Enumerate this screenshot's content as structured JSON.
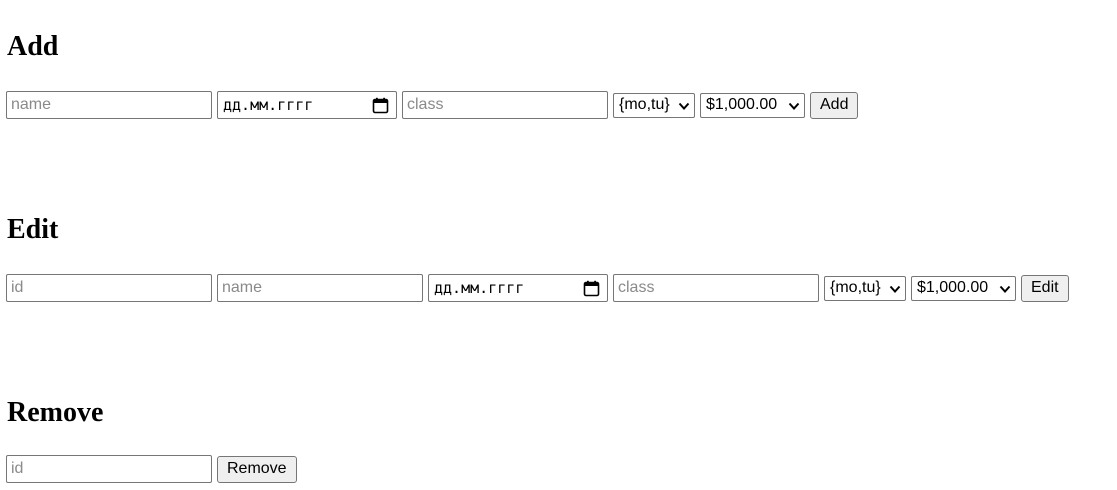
{
  "add": {
    "title": "Add",
    "name_placeholder": "name",
    "date_placeholder": "дд.мм.гггг",
    "class_placeholder": "class",
    "days_value": "{mo,tu}",
    "price_value": "$1,000.00",
    "button_label": "Add"
  },
  "edit": {
    "title": "Edit",
    "id_placeholder": "id",
    "name_placeholder": "name",
    "date_placeholder": "дд.мм.гггг",
    "class_placeholder": "class",
    "days_value": "{mo,tu}",
    "price_value": "$1,000.00",
    "button_label": "Edit"
  },
  "remove": {
    "title": "Remove",
    "id_placeholder": "id",
    "button_label": "Remove"
  },
  "icons": {
    "date_picker": "calendar-icon",
    "dropdown": "chevron-down-icon"
  }
}
